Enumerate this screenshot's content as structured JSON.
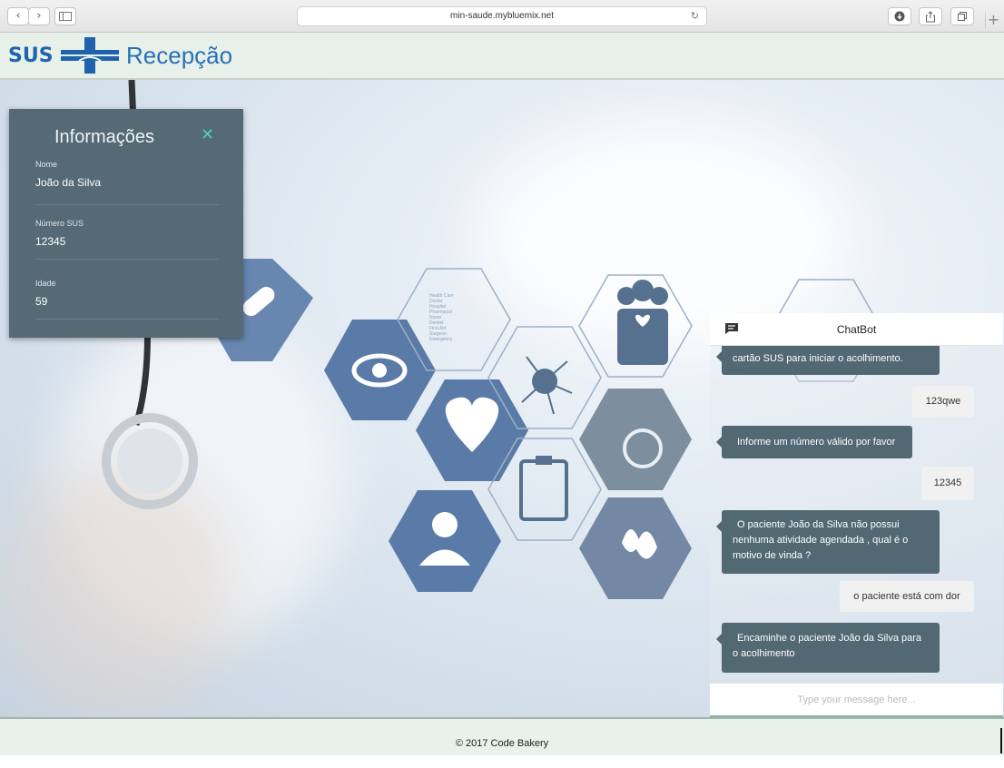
{
  "browser": {
    "url": "min-saude.mybluemix.net",
    "back_glyph": "‹",
    "forward_glyph": "›",
    "plus_glyph": "+"
  },
  "header": {
    "logo_text": "SUS",
    "title": "Recepção",
    "brand_color": "#1f63ad"
  },
  "info_panel": {
    "title": "Informações",
    "close_glyph": "✕",
    "fields": [
      {
        "label": "Nome",
        "value": "João da Silva"
      },
      {
        "label": "Número SUS",
        "value": "12345"
      },
      {
        "label": "Idade",
        "value": "59"
      }
    ]
  },
  "chat": {
    "title": "ChatBot",
    "messages": [
      {
        "from": "bot",
        "text": "cartão SUS para iniciar o acolhimento."
      },
      {
        "from": "user",
        "text": "123qwe"
      },
      {
        "from": "bot",
        "text": "Informe um número válido por favor"
      },
      {
        "from": "user",
        "text": "12345"
      },
      {
        "from": "bot",
        "text": "O paciente João da Silva não possui nenhuma atividade agendada , qual é o motivo de vinda ?"
      },
      {
        "from": "user",
        "text": "o paciente está com dor"
      },
      {
        "from": "bot",
        "text": "Encaminhe o paciente João da Silva para o acolhimento"
      }
    ],
    "input_placeholder": "Type your message here..."
  },
  "hero_icons": {
    "medical_list": [
      "Health Care",
      "Doctor",
      "Hospital",
      "Pharmacist",
      "Nurse",
      "Dentist",
      "First Aid",
      "Surgeon",
      "Emergency"
    ]
  },
  "footer": {
    "text": "© 2017 Code Bakery"
  }
}
